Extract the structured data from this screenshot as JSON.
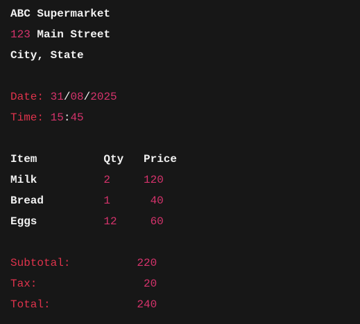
{
  "store": {
    "name": "ABC Supermarket",
    "street_number": "123",
    "street_name": "Main Street",
    "city_state": "City, State"
  },
  "date": {
    "label": "Date:",
    "day": "31",
    "month": "08",
    "year": "2025",
    "sep": "/"
  },
  "time": {
    "label": "Time:",
    "hour": "15",
    "minute": "45",
    "sep": ":"
  },
  "table": {
    "headers": [
      "Item",
      "Qty",
      "Price"
    ],
    "rows": [
      {
        "item": "Milk",
        "qty": "2",
        "price": "120"
      },
      {
        "item": "Bread",
        "qty": "1",
        "price": "40"
      },
      {
        "item": "Eggs",
        "qty": "12",
        "price": "60"
      }
    ]
  },
  "totals": [
    {
      "label": "Subtotal:",
      "value": "220"
    },
    {
      "label": "Tax:",
      "value": "20"
    },
    {
      "label": "Total:",
      "value": "240"
    }
  ],
  "colors": {
    "background": "#171717",
    "text": "#f2f2f2",
    "label": "#e0334c",
    "number": "#d6336c"
  }
}
